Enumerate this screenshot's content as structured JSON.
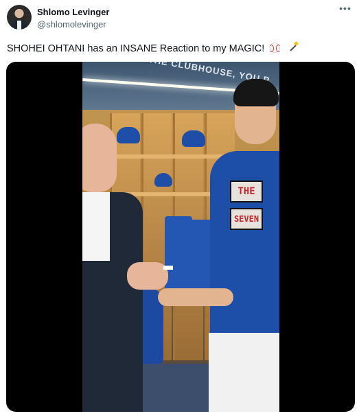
{
  "author": {
    "display_name": "Shlomo Levinger",
    "handle": "@shlomolevinger"
  },
  "more_menu_icon": "more-horizontal-icon",
  "tweet": {
    "text": "SHOHEI OHTANI has an INSANE Reaction to my MAGIC!",
    "emojis": [
      "baseball-emoji",
      "magic-wand-emoji"
    ]
  },
  "video": {
    "ceiling_sign": "THE CLUBHOUSE, YOU P",
    "shirt_text_line1": "THE",
    "shirt_text_line2": "SEVEN"
  }
}
